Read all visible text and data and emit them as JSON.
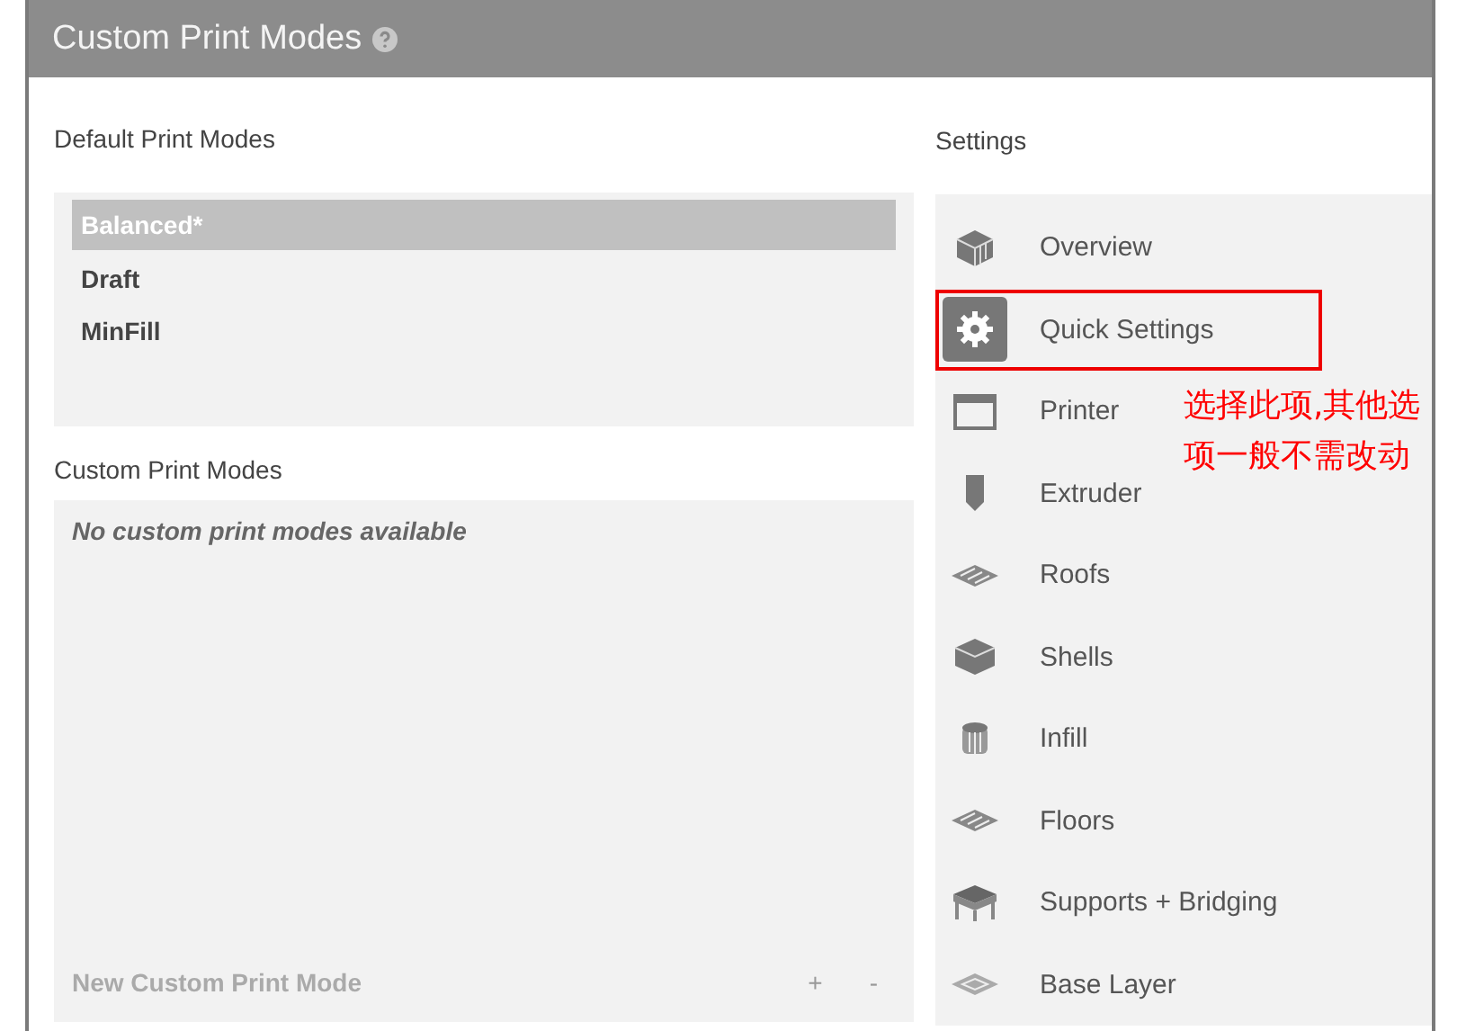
{
  "window": {
    "title": "Custom Print Modes"
  },
  "default_modes": {
    "label": "Default Print Modes",
    "items": [
      {
        "label": "Balanced*",
        "selected": true
      },
      {
        "label": "Draft",
        "selected": false
      },
      {
        "label": "MinFill",
        "selected": false
      }
    ]
  },
  "custom_modes": {
    "label": "Custom Print Modes",
    "empty_text": "No custom print modes available",
    "new_label": "New Custom Print Mode",
    "add": "+",
    "remove": "-"
  },
  "settings": {
    "label": "Settings",
    "items": [
      {
        "kind": "overview",
        "label": "Overview",
        "selected": false,
        "highlighted": false
      },
      {
        "kind": "quick",
        "label": "Quick Settings",
        "selected": true,
        "highlighted": true
      },
      {
        "kind": "printer",
        "label": "Printer",
        "selected": false,
        "highlighted": false
      },
      {
        "kind": "extruder",
        "label": "Extruder",
        "selected": false,
        "highlighted": false
      },
      {
        "kind": "roofs",
        "label": "Roofs",
        "selected": false,
        "highlighted": false
      },
      {
        "kind": "shells",
        "label": "Shells",
        "selected": false,
        "highlighted": false
      },
      {
        "kind": "infill",
        "label": "Infill",
        "selected": false,
        "highlighted": false
      },
      {
        "kind": "floors",
        "label": "Floors",
        "selected": false,
        "highlighted": false
      },
      {
        "kind": "supports",
        "label": "Supports + Bridging",
        "selected": false,
        "highlighted": false
      },
      {
        "kind": "base",
        "label": "Base Layer",
        "selected": false,
        "highlighted": false
      }
    ]
  },
  "annotation": {
    "lines": [
      "选择此项,其他选",
      "项一般不需改动"
    ]
  }
}
